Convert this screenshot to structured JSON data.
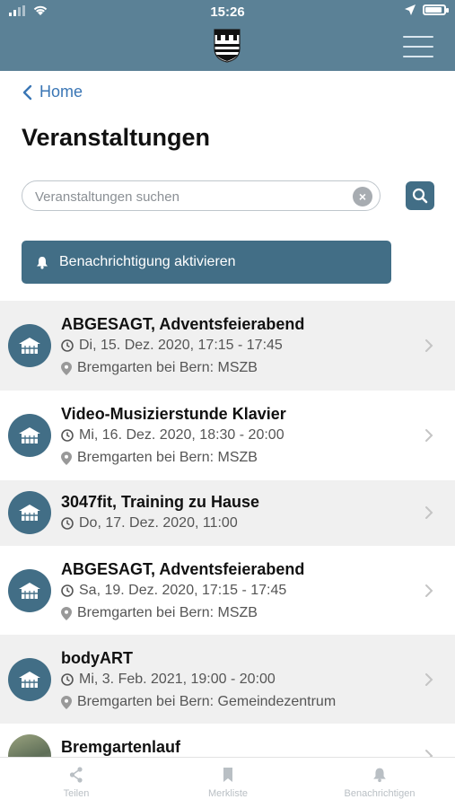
{
  "status_bar": {
    "time": "15:26"
  },
  "nav": {
    "back_label": "Home"
  },
  "page": {
    "title": "Veranstaltungen"
  },
  "search": {
    "placeholder": "Veranstaltungen suchen",
    "value": "",
    "clear_symbol": "×"
  },
  "notify_button": {
    "label": "Benachrichtigung aktivieren"
  },
  "events": [
    {
      "title": "ABGESAGT, Adventsfeierabend",
      "date": "Di, 15. Dez. 2020, 17:15 - 17:45",
      "location": "Bremgarten bei Bern: MSZB",
      "icon": "house-icon"
    },
    {
      "title": "Video-Musizierstunde Klavier",
      "date": "Mi, 16. Dez. 2020, 18:30 - 20:00",
      "location": "Bremgarten bei Bern: MSZB",
      "icon": "house-icon"
    },
    {
      "title": "3047fit, Training zu Hause",
      "date": "Do, 17. Dez. 2020, 11:00",
      "location": "",
      "icon": "house-icon"
    },
    {
      "title": "ABGESAGT, Adventsfeierabend",
      "date": "Sa, 19. Dez. 2020, 17:15 - 17:45",
      "location": "Bremgarten bei Bern: MSZB",
      "icon": "house-icon"
    },
    {
      "title": "bodyART",
      "date": "Mi, 3. Feb. 2021, 19:00 - 20:00",
      "location": "Bremgarten bei Bern: Gemeindezentrum",
      "icon": "house-icon"
    },
    {
      "title": "Bremgartenlauf",
      "date": "",
      "location": "",
      "icon": "photo-thumbnail"
    }
  ],
  "tabbar": {
    "share_label": "Teilen",
    "bookmark_label": "Merkliste",
    "notifications_label": "Benachrichtigen"
  },
  "colors": {
    "header": "#5b8196",
    "accent": "#426e86",
    "link": "#3a76b5",
    "row_alt": "#f0f0f0"
  }
}
